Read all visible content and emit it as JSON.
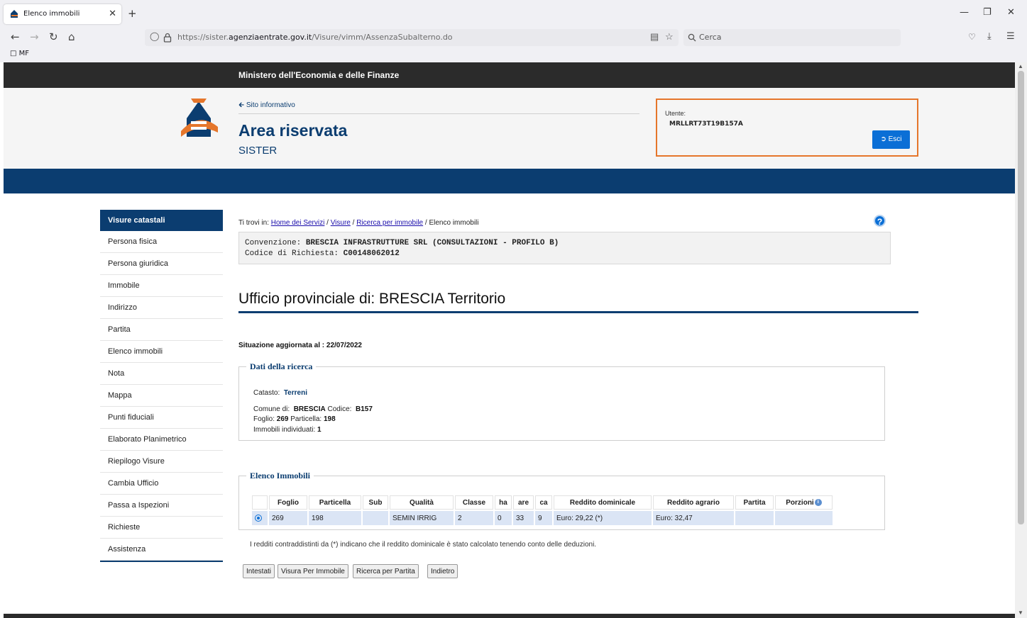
{
  "browser": {
    "tab_title": "Elenco immobili",
    "tab_close": "✕",
    "new_tab": "+",
    "url_prefix": "https://sister.",
    "url_domain": "agenziaentrate.gov.it",
    "url_path": "/Visure/vimm/AssenzaSubalterno.do",
    "search_placeholder": "Cerca",
    "bookmark_folder": "MF",
    "icons": [
      "back-icon",
      "forward-icon",
      "reload-icon",
      "home-icon",
      "shield-icon",
      "lock-icon",
      "reader-icon",
      "star-icon",
      "search-icon",
      "pocket-icon",
      "download-icon",
      "menu-icon",
      "minimize-icon",
      "restore-icon",
      "close-icon"
    ]
  },
  "header": {
    "ministry": "Ministero dell'Economia e delle Finanze",
    "sito_link": "Sito informativo",
    "area_title": "Area riservata",
    "subtitle": "SISTER",
    "user_label": "Utente:",
    "user_code": "MRLLRT73T19B157A",
    "logout_label": "Esci"
  },
  "sidebar": {
    "heading": "Visure catastali",
    "items": [
      {
        "label": "Persona fisica"
      },
      {
        "label": "Persona giuridica"
      },
      {
        "label": "Immobile"
      },
      {
        "label": "Indirizzo"
      },
      {
        "label": "Partita"
      },
      {
        "label": "Elenco immobili"
      },
      {
        "label": "Nota"
      },
      {
        "label": "Mappa"
      },
      {
        "label": "Punti fiduciali"
      },
      {
        "label": "Elaborato Planimetrico"
      },
      {
        "label": "Riepilogo Visure"
      },
      {
        "label": "Cambia Ufficio"
      },
      {
        "label": "Passa a Ispezioni"
      },
      {
        "label": "Richieste"
      },
      {
        "label": "Assistenza"
      }
    ]
  },
  "breadcrumb": {
    "prefix": "Ti trovi in:",
    "links": [
      "Home dei Servizi",
      "Visure",
      "Ricerca per immobile"
    ],
    "current": "Elenco immobili",
    "sep": "/"
  },
  "convenzione": {
    "label": "Convenzione:",
    "value": "BRESCIA INFRASTRUTTURE SRL (CONSULTAZIONI - PROFILO B)",
    "code_label": "Codice di Richiesta:",
    "code_value": "C00148062012"
  },
  "office_title": "Ufficio provinciale di: BRESCIA Territorio",
  "situazione": "Situazione aggiornata al : 22/07/2022",
  "dati_ricerca": {
    "title": "Dati della ricerca",
    "catasto_label": "Catasto:",
    "catasto_value": "Terreni",
    "comune_label": "Comune di:",
    "comune_value": "BRESCIA",
    "codice_label": "Codice:",
    "codice_value": "B157",
    "foglio_label": "Foglio:",
    "foglio_value": "269",
    "particella_label": "Particella:",
    "particella_value": "198",
    "immobili_label": "Immobili individuati:",
    "immobili_value": "1"
  },
  "elenco": {
    "title": "Elenco Immobili",
    "columns": [
      "",
      "Foglio",
      "Particella",
      "Sub",
      "Qualità",
      "Classe",
      "ha",
      "are",
      "ca",
      "Reddito dominicale",
      "Reddito agrario",
      "Partita",
      "Porzioni"
    ],
    "porzioni_info": "i",
    "rows": [
      [
        "",
        "269",
        "198",
        "",
        "SEMIN IRRIG",
        "2",
        "0",
        "33",
        "9",
        "Euro: 29,22 (*)",
        "Euro: 32,47",
        "",
        ""
      ]
    ]
  },
  "note": "I redditi contraddistinti da (*) indicano che il reddito dominicale è stato calcolato tenendo conto delle deduzioni.",
  "buttons": {
    "intestati": "Intestati",
    "visura": "Visura Per Immobile",
    "ricerca_partita": "Ricerca per Partita",
    "indietro": "Indietro"
  },
  "colors": {
    "brand_blue": "#0b3d70",
    "accent_orange": "#e5762b",
    "button_blue": "#0b6fd6",
    "table_row": "#dbe5f5"
  }
}
